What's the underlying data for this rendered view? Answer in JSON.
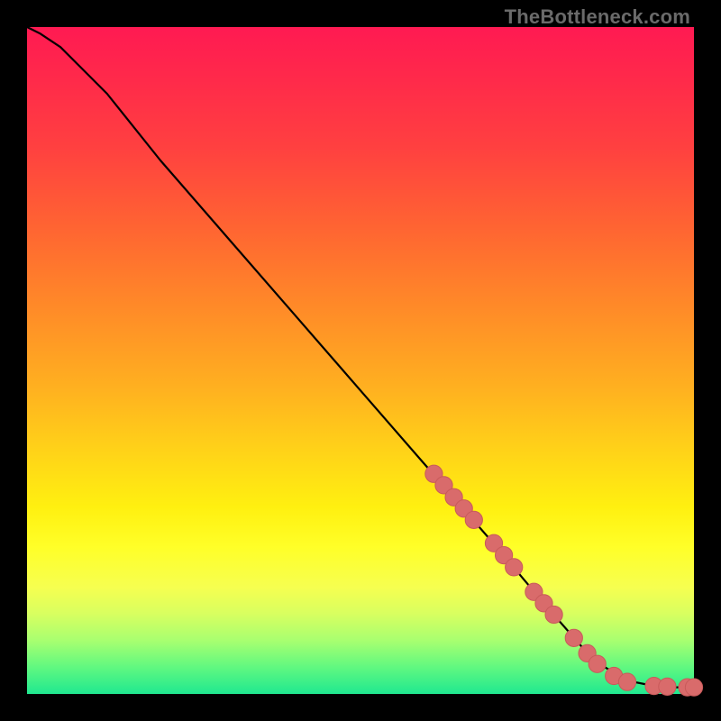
{
  "watermark": "TheBottleneck.com",
  "colors": {
    "background": "#000000",
    "curve": "#000000",
    "marker_fill": "#d96b6b",
    "marker_stroke": "#c85a5a"
  },
  "chart_data": {
    "type": "line",
    "title": "",
    "xlabel": "",
    "ylabel": "",
    "xlim": [
      0,
      100
    ],
    "ylim": [
      0,
      100
    ],
    "grid": false,
    "curve": {
      "x": [
        0,
        2,
        5,
        8,
        12,
        20,
        30,
        40,
        50,
        60,
        70,
        78,
        85,
        90,
        94,
        97,
        100
      ],
      "y": [
        100,
        99,
        97,
        94,
        90,
        80,
        68.5,
        57,
        45.5,
        34,
        22.5,
        13,
        5,
        2,
        1.2,
        1,
        1
      ]
    },
    "markers": [
      {
        "x": 61,
        "y": 33
      },
      {
        "x": 62.5,
        "y": 31.3
      },
      {
        "x": 64,
        "y": 29.5
      },
      {
        "x": 65.5,
        "y": 27.8
      },
      {
        "x": 67,
        "y": 26.1
      },
      {
        "x": 70,
        "y": 22.6
      },
      {
        "x": 71.5,
        "y": 20.8
      },
      {
        "x": 73,
        "y": 19.0
      },
      {
        "x": 76,
        "y": 15.3
      },
      {
        "x": 77.5,
        "y": 13.6
      },
      {
        "x": 79,
        "y": 11.9
      },
      {
        "x": 82,
        "y": 8.4
      },
      {
        "x": 84,
        "y": 6.1
      },
      {
        "x": 85.5,
        "y": 4.5
      },
      {
        "x": 88,
        "y": 2.7
      },
      {
        "x": 90,
        "y": 1.8
      },
      {
        "x": 94,
        "y": 1.2
      },
      {
        "x": 96,
        "y": 1.1
      },
      {
        "x": 99,
        "y": 1.0
      },
      {
        "x": 100,
        "y": 1.0
      }
    ],
    "marker_radius_data_units": 1.3
  }
}
